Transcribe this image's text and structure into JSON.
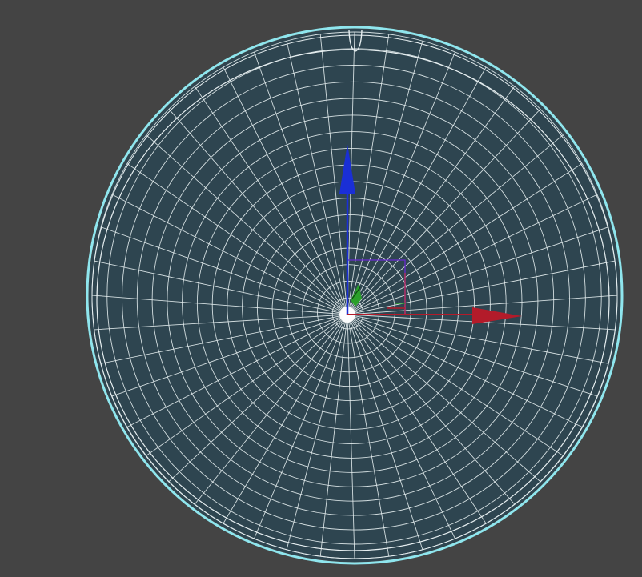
{
  "viewport": {
    "view": "top",
    "shading": "wireframe-on-shaded",
    "selected": true
  },
  "colors": {
    "background": "#444444",
    "surface": "#2e4550",
    "wire": "#e6eef0",
    "selection_outline": "#8fe6ee",
    "gizmo_x": "#b31b2a",
    "gizmo_y": "#1a2fd6",
    "gizmo_z": "#2aa02a",
    "gizmo_plane_y": "#6a2ad0",
    "gizmo_plane_x": "#c0305a"
  },
  "object": {
    "type": "disc",
    "rings": 17,
    "segments": 48,
    "has_rim_notch": true
  },
  "gizmo": {
    "mode": "move",
    "axes": [
      "x",
      "y",
      "z"
    ],
    "icons": {
      "x": "arrow-right-icon",
      "y": "arrow-up-icon",
      "z": "pivot-icon"
    }
  }
}
